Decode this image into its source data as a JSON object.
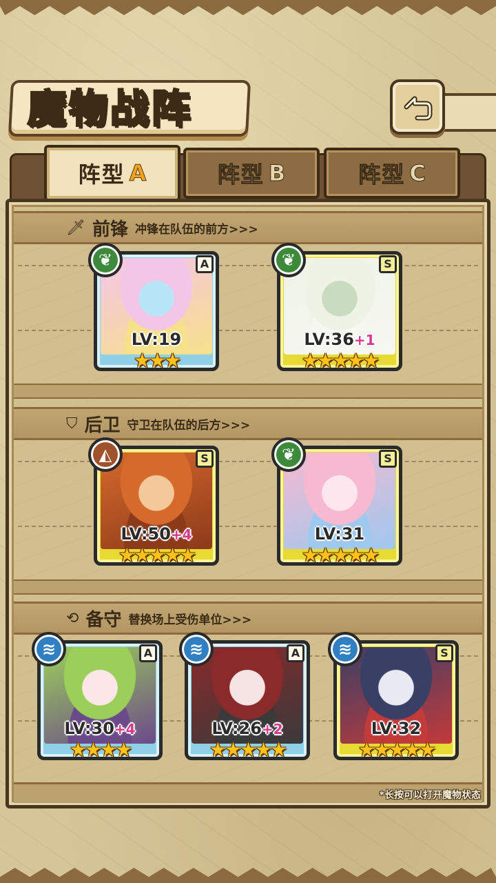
{
  "header": {
    "title": "魔物战阵",
    "back_icon": "back-arrow-icon"
  },
  "tabs": [
    {
      "label": "阵型",
      "suffix": "A",
      "active": true
    },
    {
      "label": "阵型",
      "suffix": "B",
      "active": false
    },
    {
      "label": "阵型",
      "suffix": "C",
      "active": false
    }
  ],
  "sections": {
    "front": {
      "icon": "sword-icon",
      "name": "前锋",
      "desc": "冲锋在队伍的前方>>>"
    },
    "rear": {
      "icon": "shield-icon",
      "name": "后卫",
      "desc": "守卫在队伍的后方>>>"
    },
    "reserve": {
      "icon": "swap-icon",
      "name": "备守",
      "desc": "替换场上受伤单位>>>"
    }
  },
  "cards": [
    {
      "rank": "A",
      "element": "leaf",
      "level": "LV:19",
      "bonus": "",
      "stars": "★★★",
      "star_count": 3,
      "art_colors": [
        "#f3c6e8",
        "#b9e6f7",
        "#f7e08a"
      ]
    },
    {
      "rank": "S",
      "element": "leaf",
      "level": "LV:36",
      "bonus": "+1",
      "stars": "★★★★★",
      "star_count": 5,
      "art_colors": [
        "#eef3e6",
        "#c9dcbf",
        "#f7f7f2"
      ]
    },
    {
      "rank": "S",
      "element": "earth",
      "level": "LV:50",
      "bonus": "+4",
      "stars": "★★★★★",
      "star_count": 5,
      "art_colors": [
        "#d66a2c",
        "#f3c89a",
        "#8c3a1a"
      ]
    },
    {
      "rank": "S",
      "element": "leaf",
      "level": "LV:31",
      "bonus": "",
      "stars": "★★★★★",
      "star_count": 5,
      "art_colors": [
        "#f6b9cf",
        "#fde6ee",
        "#9fc8ef"
      ]
    },
    {
      "rank": "A",
      "element": "water",
      "level": "LV:30",
      "bonus": "+4",
      "stars": "★★★★",
      "star_count": 4,
      "art_colors": [
        "#9ccf5a",
        "#fbe7e7",
        "#6b4a8a"
      ]
    },
    {
      "rank": "A",
      "element": "water",
      "level": "LV:26",
      "bonus": "+2",
      "stars": "★★★★★",
      "star_count": 5,
      "art_colors": [
        "#8a2a2a",
        "#f6e3e3",
        "#3a3a3a"
      ]
    },
    {
      "rank": "S",
      "element": "water",
      "level": "LV:32",
      "bonus": "",
      "stars": "★★★★★",
      "star_count": 5,
      "art_colors": [
        "#3a3f66",
        "#e9e9f2",
        "#c23a3a"
      ]
    }
  ],
  "hint": "*长按可以打开魔物状态"
}
